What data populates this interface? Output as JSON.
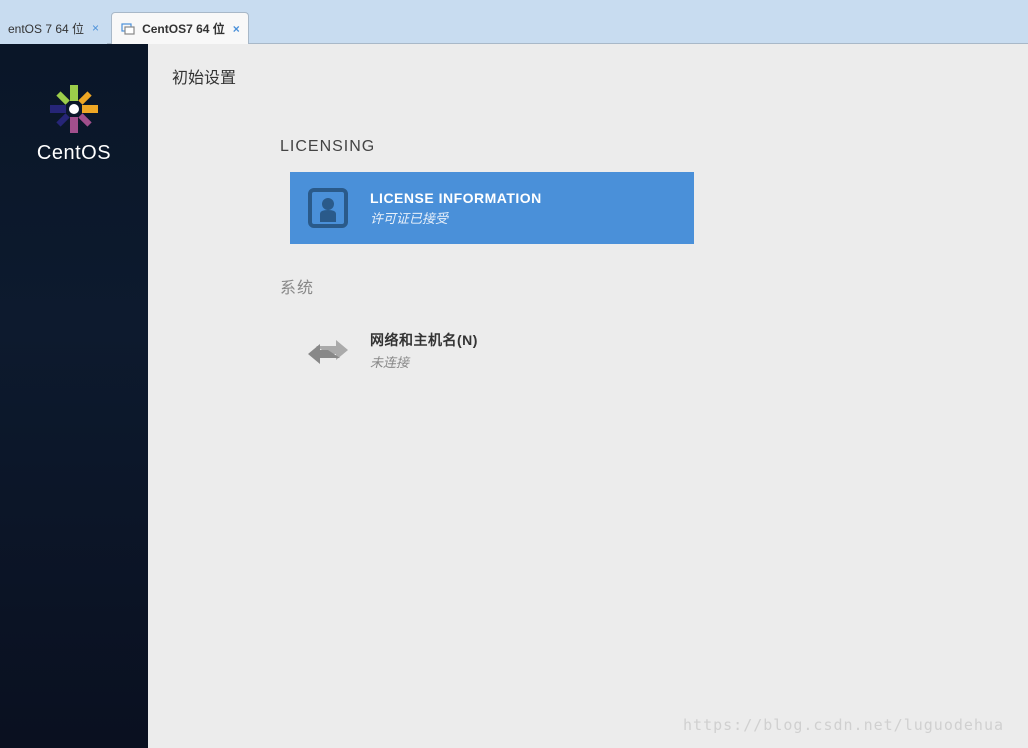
{
  "tabs": [
    {
      "label": "entOS 7 64 位",
      "active": false
    },
    {
      "label": "CentOS7 64 位",
      "active": true
    }
  ],
  "sidebar": {
    "brand": "CentOS"
  },
  "content": {
    "page_title": "初始设置",
    "sections": [
      {
        "heading": "LICENSING",
        "spokes": [
          {
            "title": "LICENSE INFORMATION",
            "status": "许可证已接受",
            "highlighted": true,
            "icon": "license"
          }
        ]
      },
      {
        "heading": "系统",
        "spokes": [
          {
            "title": "网络和主机名(N)",
            "status": "未连接",
            "highlighted": false,
            "icon": "network"
          }
        ]
      }
    ]
  },
  "watermark": "https://blog.csdn.net/luguodehua"
}
